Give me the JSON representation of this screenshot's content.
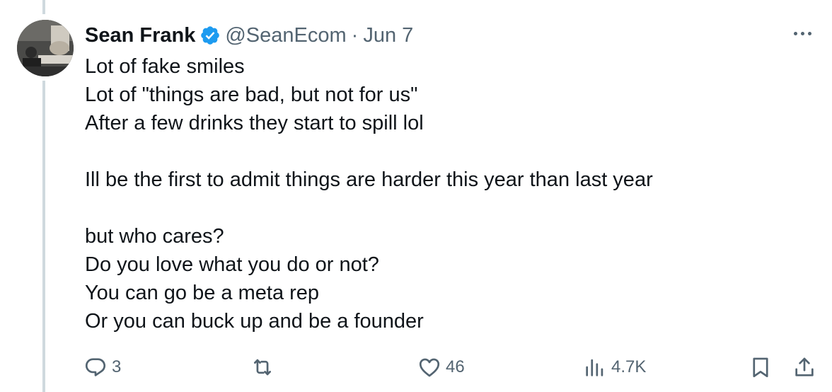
{
  "author": {
    "name": "Sean Frank",
    "handle": "@SeanEcom",
    "separator": "·",
    "date": "Jun 7"
  },
  "tweet": {
    "lines": [
      "Lot of fake smiles",
      "Lot of \"things are bad, but not for us\"",
      "After a few drinks they start to spill lol",
      "",
      "Ill be the first to admit things are harder this year than last year",
      "",
      "but who cares?",
      "Do you love what you do or not?",
      "You can go be a meta rep",
      "Or you can buck up and be a founder"
    ]
  },
  "actions": {
    "reply_count": "3",
    "retweet_count": "",
    "like_count": "46",
    "view_count": "4.7K"
  },
  "icons": {
    "verified": "verified-badge-icon",
    "more": "more-options-icon",
    "reply": "reply-icon",
    "retweet": "retweet-icon",
    "like": "like-icon",
    "views": "views-icon",
    "bookmark": "bookmark-icon",
    "share": "share-icon"
  },
  "colors": {
    "text": "#0f1419",
    "secondary": "#536471",
    "verified": "#1d9bf0",
    "thread_line": "#cfd9de"
  }
}
